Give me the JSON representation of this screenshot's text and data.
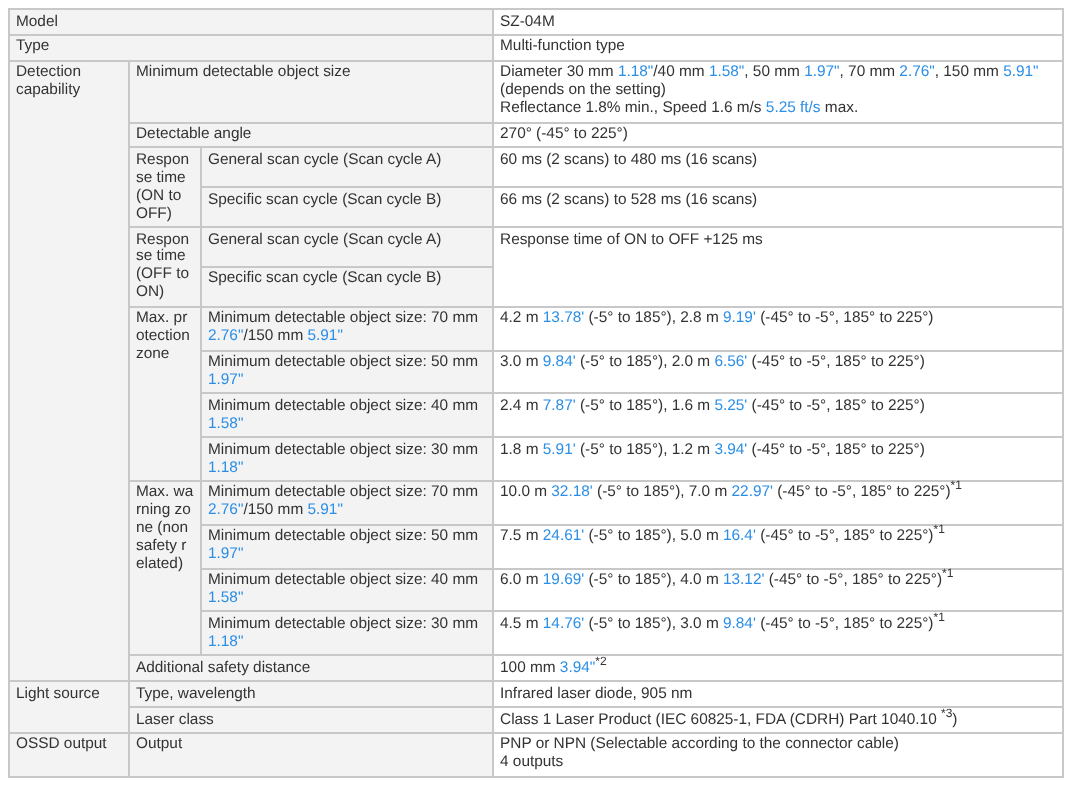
{
  "spec_table": [
    {
      "label": "Model",
      "value": [
        [
          {
            "kind": "text",
            "text": "SZ-04M"
          }
        ]
      ]
    },
    {
      "label": "Type",
      "value": [
        [
          {
            "kind": "text",
            "text": "Multi-function type"
          }
        ]
      ]
    },
    {
      "label": "Detection capability",
      "items": [
        {
          "label": "Minimum detectable object size",
          "value": [
            [
              {
                "kind": "text",
                "text": "Diameter 30 mm "
              },
              {
                "kind": "imperial",
                "text": "1.18\""
              },
              {
                "kind": "text",
                "text": "/40 mm "
              },
              {
                "kind": "imperial",
                "text": "1.58\""
              },
              {
                "kind": "text",
                "text": ", 50 mm "
              },
              {
                "kind": "imperial",
                "text": "1.97\""
              },
              {
                "kind": "text",
                "text": ", 70 mm "
              },
              {
                "kind": "imperial",
                "text": "2.76\""
              },
              {
                "kind": "text",
                "text": ", 150 mm "
              },
              {
                "kind": "imperial",
                "text": "5.91\""
              },
              {
                "kind": "text",
                "text": " (depends on the setting)"
              }
            ],
            [
              {
                "kind": "text",
                "text": "Reflectance 1.8% min., Speed 1.6 m/s "
              },
              {
                "kind": "imperial",
                "text": "5.25 ft/s"
              },
              {
                "kind": "text",
                "text": " max."
              }
            ]
          ]
        },
        {
          "label": "Detectable angle",
          "value": [
            [
              {
                "kind": "text",
                "text": "270° (-45° to 225°)"
              }
            ]
          ]
        },
        {
          "label": "Response time (ON to OFF)",
          "items": [
            {
              "label": "General scan cycle (Scan cycle A)",
              "value": [
                [
                  {
                    "kind": "text",
                    "text": "60 ms (2 scans) to 480 ms (16 scans)"
                  }
                ]
              ]
            },
            {
              "label": "Specific scan cycle (Scan cycle B)",
              "value": [
                [
                  {
                    "kind": "text",
                    "text": "66 ms (2 scans) to 528 ms (16 scans)"
                  }
                ]
              ]
            }
          ]
        },
        {
          "label": "Response time (OFF to ON)",
          "items": [
            {
              "label": "General scan cycle (Scan cycle A)",
              "value": [
                [
                  {
                    "kind": "text",
                    "text": "Response time of ON to OFF +125 ms"
                  }
                ]
              ]
            },
            {
              "label": "Specific scan cycle (Scan cycle B)"
            }
          ]
        },
        {
          "label": "Max. protection zone",
          "items": [
            {
              "label": [
                {
                  "kind": "text",
                  "text": "Minimum detectable object size: 70 mm "
                },
                {
                  "kind": "imperial",
                  "text": "2.76\""
                },
                {
                  "kind": "text",
                  "text": "/150 mm "
                },
                {
                  "kind": "imperial",
                  "text": "5.91\""
                }
              ],
              "value": [
                [
                  {
                    "kind": "text",
                    "text": "4.2 m "
                  },
                  {
                    "kind": "imperial",
                    "text": "13.78'"
                  },
                  {
                    "kind": "text",
                    "text": " (-5° to 185°), 2.8 m "
                  },
                  {
                    "kind": "imperial",
                    "text": "9.19'"
                  },
                  {
                    "kind": "text",
                    "text": " (-45° to -5°, 185° to 225°)"
                  }
                ]
              ]
            },
            {
              "label": [
                {
                  "kind": "text",
                  "text": "Minimum detectable object size: 50 mm "
                },
                {
                  "kind": "imperial",
                  "text": "1.97\""
                }
              ],
              "value": [
                [
                  {
                    "kind": "text",
                    "text": "3.0 m "
                  },
                  {
                    "kind": "imperial",
                    "text": "9.84'"
                  },
                  {
                    "kind": "text",
                    "text": " (-5° to 185°), 2.0 m "
                  },
                  {
                    "kind": "imperial",
                    "text": "6.56'"
                  },
                  {
                    "kind": "text",
                    "text": " (-45° to -5°, 185° to 225°)"
                  }
                ]
              ]
            },
            {
              "label": [
                {
                  "kind": "text",
                  "text": "Minimum detectable object size: 40 mm "
                },
                {
                  "kind": "imperial",
                  "text": "1.58\""
                }
              ],
              "value": [
                [
                  {
                    "kind": "text",
                    "text": "2.4 m "
                  },
                  {
                    "kind": "imperial",
                    "text": "7.87'"
                  },
                  {
                    "kind": "text",
                    "text": " (-5° to 185°), 1.6 m "
                  },
                  {
                    "kind": "imperial",
                    "text": "5.25'"
                  },
                  {
                    "kind": "text",
                    "text": " (-45° to -5°, 185° to 225°)"
                  }
                ]
              ]
            },
            {
              "label": [
                {
                  "kind": "text",
                  "text": "Minimum detectable object size: 30 mm "
                },
                {
                  "kind": "imperial",
                  "text": "1.18\""
                }
              ],
              "value": [
                [
                  {
                    "kind": "text",
                    "text": "1.8 m "
                  },
                  {
                    "kind": "imperial",
                    "text": "5.91'"
                  },
                  {
                    "kind": "text",
                    "text": " (-5° to 185°), 1.2 m "
                  },
                  {
                    "kind": "imperial",
                    "text": "3.94'"
                  },
                  {
                    "kind": "text",
                    "text": " (-45° to -5°, 185° to 225°)"
                  }
                ]
              ]
            }
          ]
        },
        {
          "label": "Max. warning zone (non safety related)",
          "items": [
            {
              "label": [
                {
                  "kind": "text",
                  "text": "Minimum detectable object size: 70 mm "
                },
                {
                  "kind": "imperial",
                  "text": "2.76\""
                },
                {
                  "kind": "text",
                  "text": "/150 mm "
                },
                {
                  "kind": "imperial",
                  "text": "5.91\""
                }
              ],
              "value": [
                [
                  {
                    "kind": "text",
                    "text": "10.0 m "
                  },
                  {
                    "kind": "imperial",
                    "text": "32.18'"
                  },
                  {
                    "kind": "text",
                    "text": " (-5° to 185°), 7.0 m "
                  },
                  {
                    "kind": "imperial",
                    "text": "22.97'"
                  },
                  {
                    "kind": "text",
                    "text": " (-45° to -5°, 185° to 225°)"
                  },
                  {
                    "kind": "note",
                    "text": "*1"
                  }
                ]
              ]
            },
            {
              "label": [
                {
                  "kind": "text",
                  "text": "Minimum detectable object size: 50 mm "
                },
                {
                  "kind": "imperial",
                  "text": "1.97\""
                }
              ],
              "value": [
                [
                  {
                    "kind": "text",
                    "text": "7.5 m "
                  },
                  {
                    "kind": "imperial",
                    "text": "24.61'"
                  },
                  {
                    "kind": "text",
                    "text": " (-5° to 185°), 5.0 m "
                  },
                  {
                    "kind": "imperial",
                    "text": "16.4'"
                  },
                  {
                    "kind": "text",
                    "text": " (-45° to -5°, 185° to 225°)"
                  },
                  {
                    "kind": "note",
                    "text": "*1"
                  }
                ]
              ]
            },
            {
              "label": [
                {
                  "kind": "text",
                  "text": "Minimum detectable object size: 40 mm "
                },
                {
                  "kind": "imperial",
                  "text": "1.58\""
                }
              ],
              "value": [
                [
                  {
                    "kind": "text",
                    "text": "6.0 m "
                  },
                  {
                    "kind": "imperial",
                    "text": "19.69'"
                  },
                  {
                    "kind": "text",
                    "text": " (-5° to 185°), 4.0 m "
                  },
                  {
                    "kind": "imperial",
                    "text": "13.12'"
                  },
                  {
                    "kind": "text",
                    "text": " (-45° to -5°, 185° to 225°)"
                  },
                  {
                    "kind": "note",
                    "text": "*1"
                  }
                ]
              ]
            },
            {
              "label": [
                {
                  "kind": "text",
                  "text": "Minimum detectable object size: 30 mm "
                },
                {
                  "kind": "imperial",
                  "text": "1.18\""
                }
              ],
              "value": [
                [
                  {
                    "kind": "text",
                    "text": "4.5 m "
                  },
                  {
                    "kind": "imperial",
                    "text": "14.76'"
                  },
                  {
                    "kind": "text",
                    "text": " (-5° to 185°), 3.0 m "
                  },
                  {
                    "kind": "imperial",
                    "text": "9.84'"
                  },
                  {
                    "kind": "text",
                    "text": " (-45° to -5°, 185° to 225°)"
                  },
                  {
                    "kind": "note",
                    "text": "*1"
                  }
                ]
              ]
            }
          ]
        },
        {
          "label": "Additional safety distance",
          "value": [
            [
              {
                "kind": "text",
                "text": "100 mm "
              },
              {
                "kind": "imperial",
                "text": "3.94\""
              },
              {
                "kind": "note",
                "text": "*2"
              }
            ]
          ]
        }
      ]
    },
    {
      "label": "Light source",
      "items": [
        {
          "label": "Type, wavelength",
          "value": [
            [
              {
                "kind": "text",
                "text": "Infrared laser diode, 905 nm"
              }
            ]
          ]
        },
        {
          "label": "Laser class",
          "value": [
            [
              {
                "kind": "text",
                "text": "Class 1 Laser Product (IEC 60825-1, FDA (CDRH) Part 1040.10 "
              },
              {
                "kind": "note",
                "text": "*3"
              },
              {
                "kind": "text",
                "text": ")"
              }
            ]
          ]
        }
      ]
    },
    {
      "label": "OSSD output",
      "items": [
        {
          "label": "Output",
          "value": [
            [
              {
                "kind": "text",
                "text": "PNP or NPN (Selectable according to the connector cable)"
              }
            ],
            [
              {
                "kind": "text",
                "text": "4 outputs"
              }
            ]
          ]
        }
      ]
    }
  ]
}
